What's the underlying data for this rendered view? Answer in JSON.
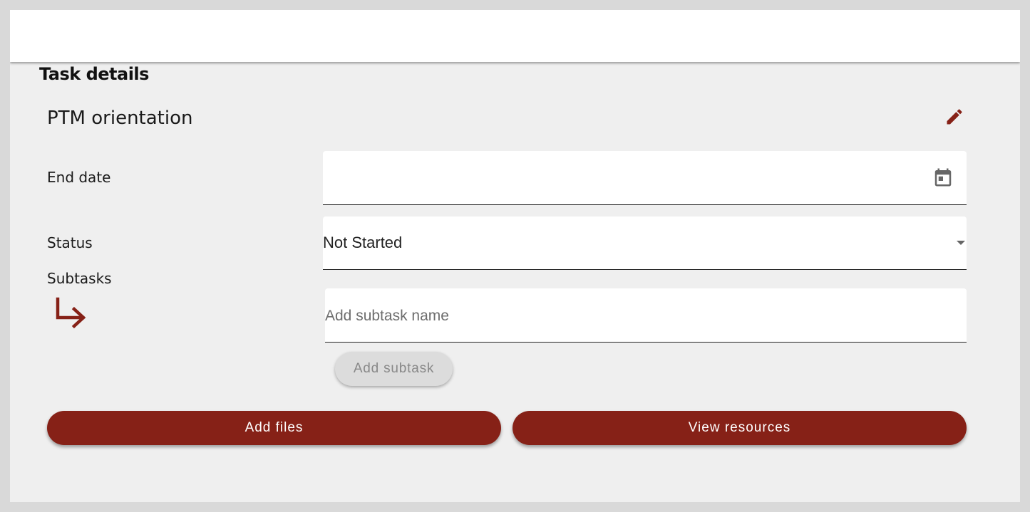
{
  "section_title": "Task details",
  "task": {
    "name": "PTM orientation"
  },
  "fields": {
    "end_date": {
      "label": "End date",
      "value": ""
    },
    "status": {
      "label": "Status",
      "value": "Not Started"
    },
    "subtasks": {
      "label": "Subtasks",
      "placeholder": "Add subtask name"
    }
  },
  "buttons": {
    "add_subtask": "Add subtask",
    "add_files": "Add files",
    "view_resources": "View resources"
  },
  "icons": {
    "edit": "pencil-icon",
    "calendar": "calendar-icon",
    "subtask_arrow": "arrow-down-right-icon",
    "dropdown": "chevron-down-icon"
  },
  "colors": {
    "accent": "#862117",
    "background": "#efefef",
    "field_background": "#ffffff"
  }
}
